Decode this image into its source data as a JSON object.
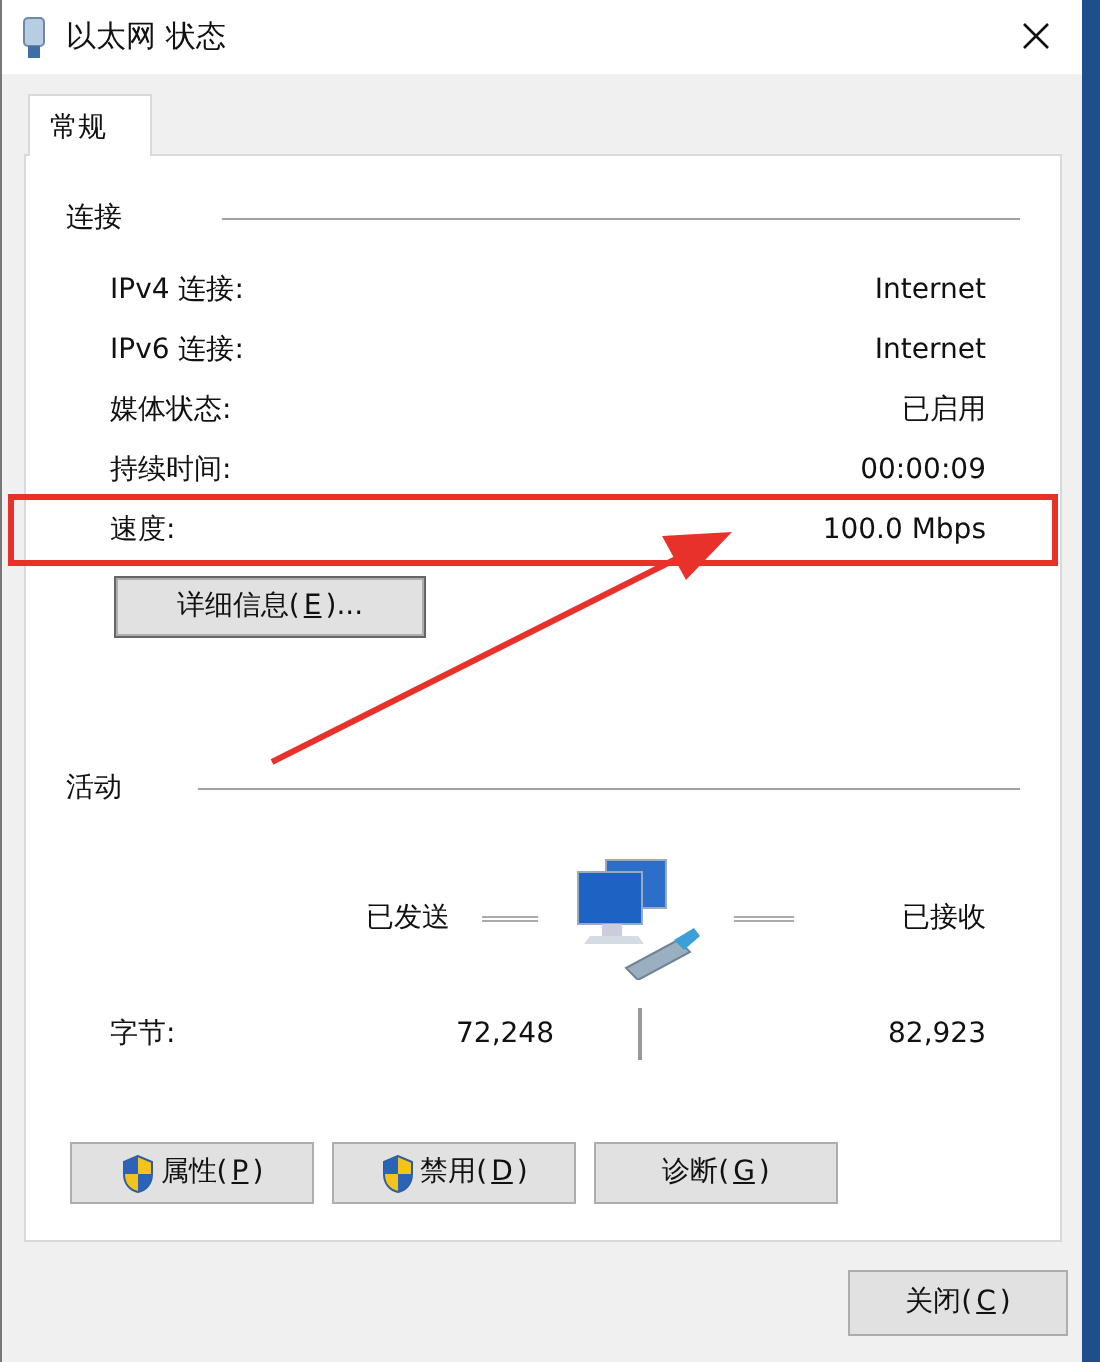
{
  "window": {
    "title": "以太网 状态"
  },
  "tabs": [
    {
      "label": "常规",
      "selected": true
    }
  ],
  "connection": {
    "heading": "连接",
    "rows": [
      {
        "label": "IPv4 连接:",
        "value": "Internet",
        "highlighted": false
      },
      {
        "label": "IPv6 连接:",
        "value": "Internet",
        "highlighted": false
      },
      {
        "label": "媒体状态:",
        "value": "已启用",
        "highlighted": false
      },
      {
        "label": "持续时间:",
        "value": "00:00:09",
        "highlighted": false
      },
      {
        "label": "速度:",
        "value": "100.0 Mbps",
        "highlighted": true
      }
    ],
    "details_button": {
      "parts": [
        "详细信息(",
        "E",
        ")..."
      ]
    }
  },
  "activity": {
    "heading": "活动",
    "sent_label": "已发送",
    "received_label": "已接收",
    "bytes_label": "字节:",
    "sent": "72,248",
    "received": "82,923"
  },
  "buttons": [
    {
      "parts": [
        "属性(",
        "P",
        ")"
      ],
      "shield": true
    },
    {
      "parts": [
        "禁用(",
        "D",
        ")"
      ],
      "shield": true
    },
    {
      "parts": [
        "诊断(",
        "G",
        ")"
      ],
      "shield": false
    }
  ],
  "close_button": {
    "parts": [
      "关闭(",
      "C",
      ")"
    ]
  }
}
